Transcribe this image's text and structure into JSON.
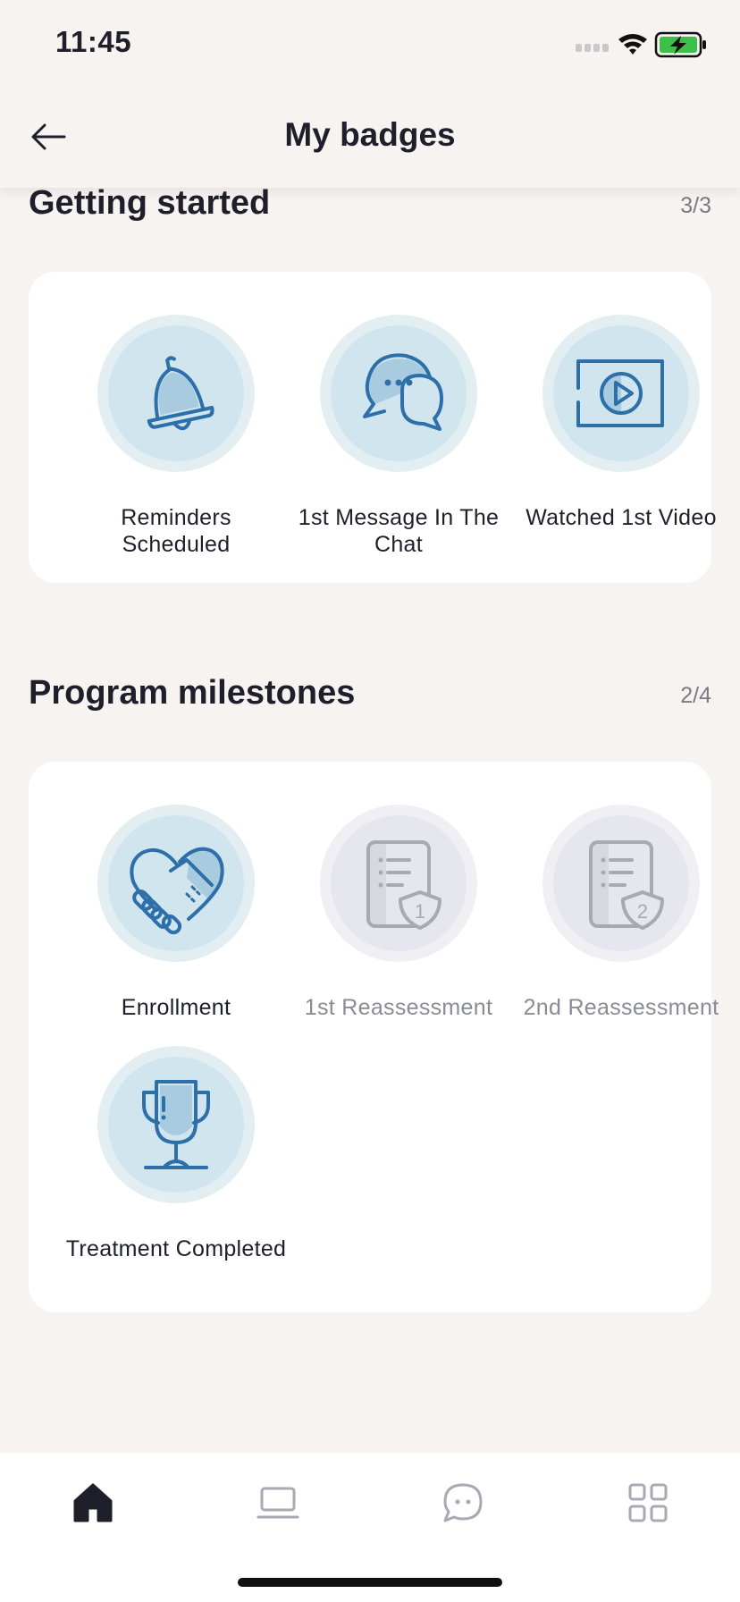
{
  "status_bar": {
    "time": "11:45"
  },
  "header": {
    "title": "My badges"
  },
  "sections": [
    {
      "title": "Getting started",
      "count": "3/3",
      "badges": [
        {
          "label": "Reminders Scheduled",
          "icon": "bell-icon",
          "earned": true
        },
        {
          "label": "1st Message In The Chat",
          "icon": "chat-bubbles-icon",
          "earned": true
        },
        {
          "label": "Watched 1st Video",
          "icon": "video-play-icon",
          "earned": true
        }
      ]
    },
    {
      "title": "Program milestones",
      "count": "2/4",
      "badges": [
        {
          "label": "Enrollment",
          "icon": "handshake-heart-icon",
          "earned": true
        },
        {
          "label": "1st Reassessment",
          "icon": "document-shield-icon",
          "number": "1",
          "earned": false
        },
        {
          "label": "2nd Reassessment",
          "icon": "document-shield-icon",
          "number": "2",
          "earned": false
        },
        {
          "label": "Treatment Completed",
          "icon": "trophy-icon",
          "earned": true
        }
      ]
    }
  ],
  "tab_bar": {
    "items": [
      {
        "name": "home",
        "icon": "home-icon",
        "active": true
      },
      {
        "name": "lessons",
        "icon": "laptop-icon",
        "active": false
      },
      {
        "name": "chat",
        "icon": "chat-icon",
        "active": false
      },
      {
        "name": "more",
        "icon": "grid-icon",
        "active": false
      }
    ]
  },
  "colors": {
    "accent": "#2d6fa8",
    "badge_bg": "#d0e5ee",
    "locked": "#a9a9b3",
    "background": "#f6f3f1"
  }
}
